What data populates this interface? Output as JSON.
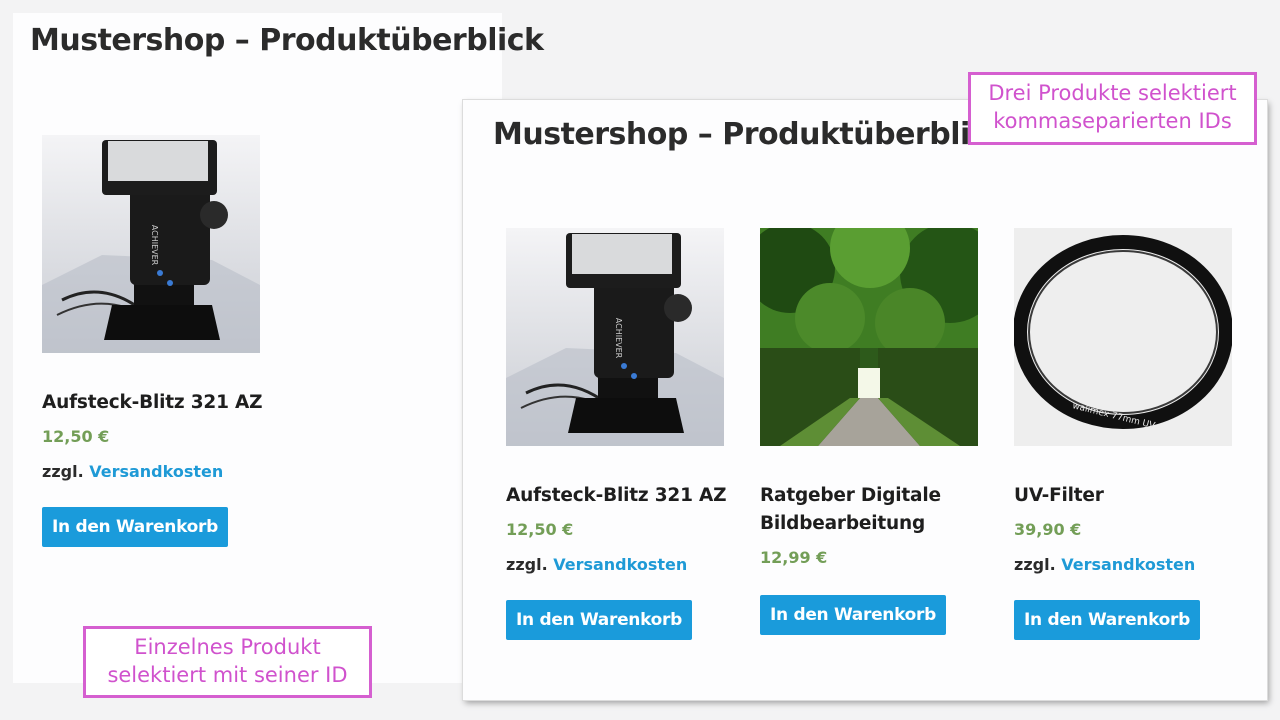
{
  "single_view": {
    "title": "Mustershop – Produktüberblick",
    "products": [
      {
        "name": "Aufsteck-Blitz 321 AZ",
        "price": "12,50 €",
        "shipping_prefix": "zzgl.",
        "shipping_link": "Versandkosten",
        "button": "In den Warenkorb",
        "brand_text": "ACHIEVER"
      }
    ]
  },
  "multi_view": {
    "title": "Mustershop – Produktüberblick",
    "products": [
      {
        "name": "Aufsteck-Blitz 321 AZ",
        "price": "12,50 €",
        "shipping_prefix": "zzgl.",
        "shipping_link": "Versandkosten",
        "button": "In den Warenkorb",
        "brand_text": "ACHIEVER"
      },
      {
        "name": "Ratgeber Digitale Bildbearbeitung",
        "price": "12,99 €",
        "button": "In den Warenkorb"
      },
      {
        "name": "UV-Filter",
        "price": "39,90 €",
        "shipping_prefix": "zzgl.",
        "shipping_link": "Versandkosten",
        "button": "In den Warenkorb",
        "filter_text": "walimex  77mm  UV"
      }
    ]
  },
  "callouts": {
    "multi": "Drei Produkte selektiert kommaseparierten IDs",
    "single": "Einzelnes Produkt selektiert mit seiner ID"
  },
  "colors": {
    "price": "#739e57",
    "link": "#1f9ad6",
    "button": "#1a9bdb",
    "callout": "#d55fd0"
  }
}
